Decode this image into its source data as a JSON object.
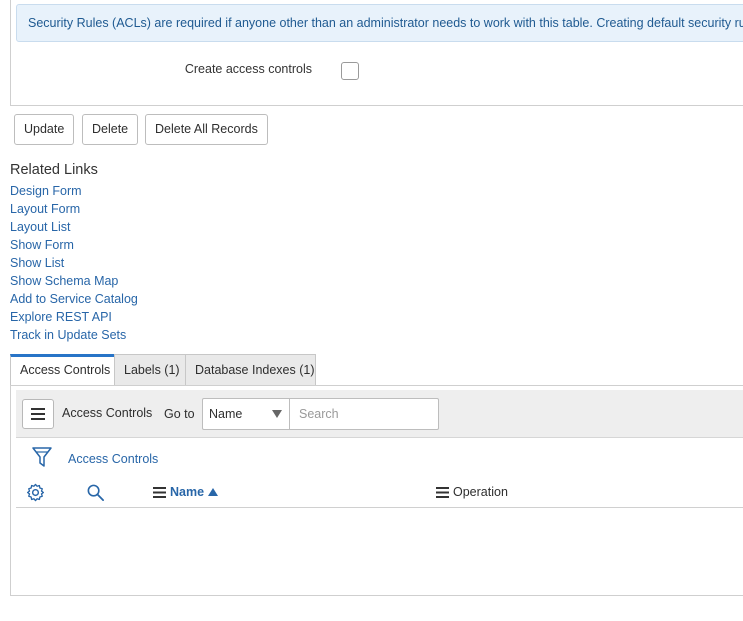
{
  "form": {
    "info_banner": "Security Rules (ACLs) are required if anyone other than an administrator needs to work with this table. Creating default security rules",
    "create_access_controls_label": "Create access controls"
  },
  "buttons": {
    "update": "Update",
    "delete": "Delete",
    "delete_all": "Delete All Records"
  },
  "related_links": {
    "title": "Related Links",
    "items": [
      "Design Form",
      "Layout Form",
      "Layout List",
      "Show Form",
      "Show List",
      "Show Schema Map",
      "Add to Service Catalog",
      "Explore REST API",
      "Track in Update Sets"
    ]
  },
  "tabs": [
    {
      "label": "Access Controls",
      "active": true
    },
    {
      "label": "Labels (1)",
      "active": false
    },
    {
      "label": "Database Indexes (1)",
      "active": false
    }
  ],
  "list": {
    "toolbar_title": "Access Controls",
    "goto_label": "Go to",
    "goto_selected": "Name",
    "search_placeholder": "Search",
    "breadcrumb": "Access Controls",
    "columns": [
      {
        "label": "Name",
        "sorted": "ascending"
      },
      {
        "label": "Operation"
      }
    ]
  },
  "colors": {
    "link": "#2866a8",
    "banner_bg": "#e8f2fb",
    "tab_active_accent": "#2874c7"
  },
  "icons": [
    "hamburger-menu-icon",
    "filter-funnel-icon",
    "gear-icon",
    "magnifier-icon",
    "sort-ascending-icon",
    "column-menu-icon",
    "dropdown-caret-icon"
  ]
}
